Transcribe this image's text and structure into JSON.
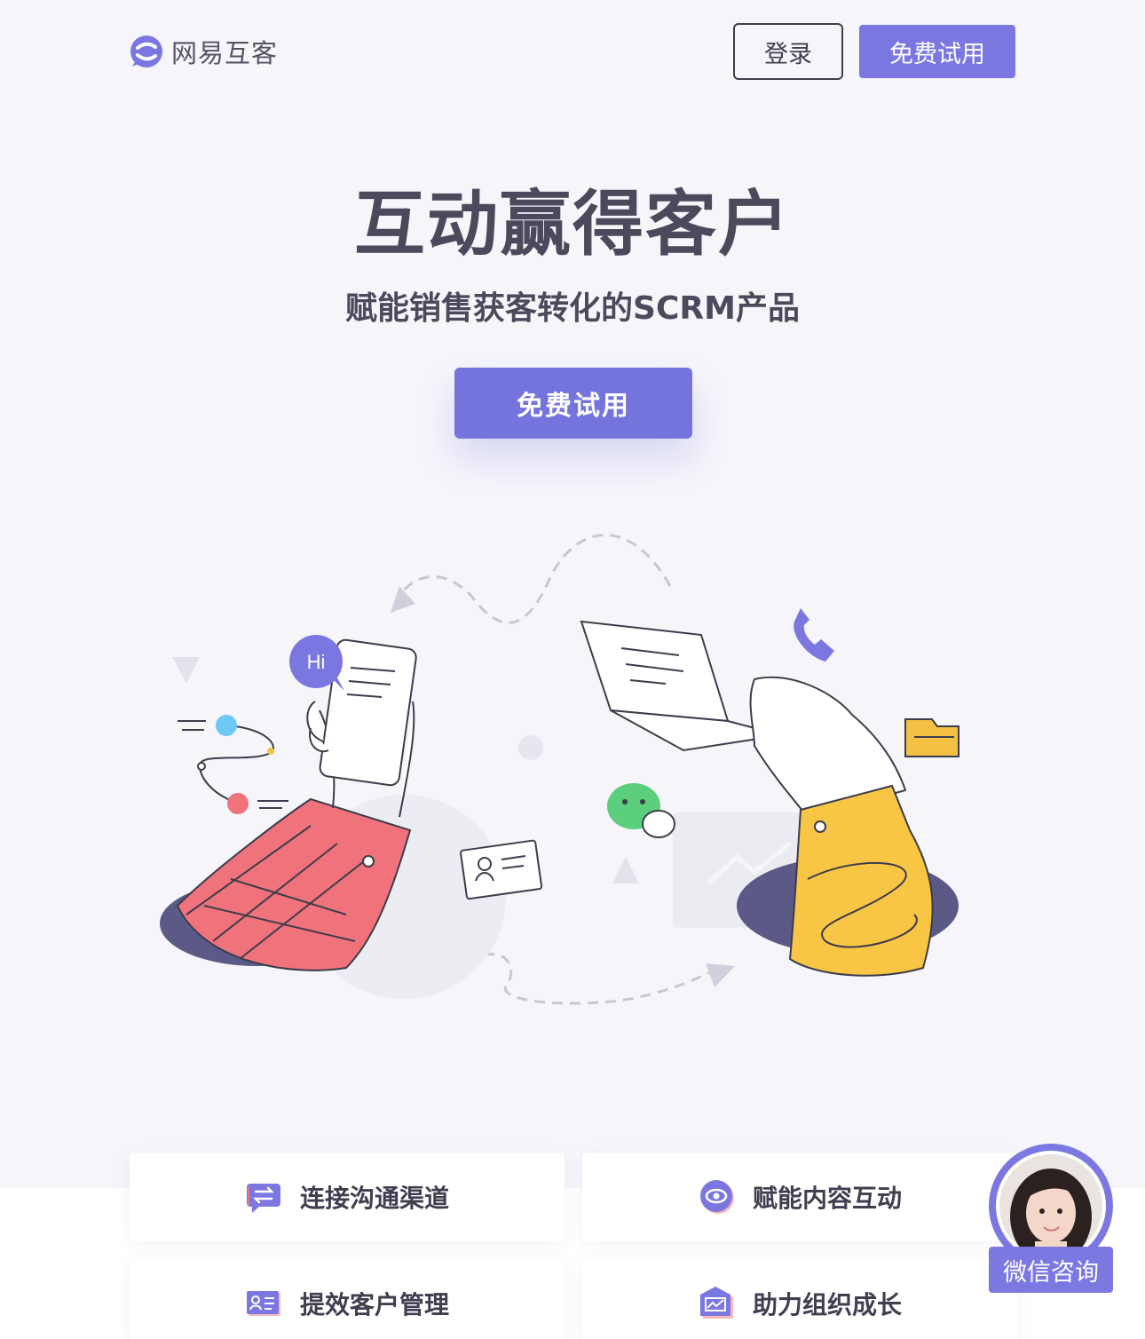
{
  "header": {
    "logo_text": "网易互客",
    "login_label": "登录",
    "trial_label": "免费试用"
  },
  "hero": {
    "title": "互动赢得客户",
    "subtitle": "赋能销售获客转化的SCRM产品",
    "cta_label": "免费试用",
    "bubble_text": "Hi"
  },
  "features": [
    {
      "label": "连接沟通渠道",
      "icon": "chat-exchange-icon"
    },
    {
      "label": "赋能内容互动",
      "icon": "eye-icon"
    },
    {
      "label": "提效客户管理",
      "icon": "contact-card-icon"
    },
    {
      "label": "助力组织成长",
      "icon": "growth-chart-icon"
    }
  ],
  "floating": {
    "wechat_label": "微信咨询"
  },
  "colors": {
    "accent": "#7574dd",
    "background": "#f5f5fa",
    "text": "#4a4a5c"
  }
}
